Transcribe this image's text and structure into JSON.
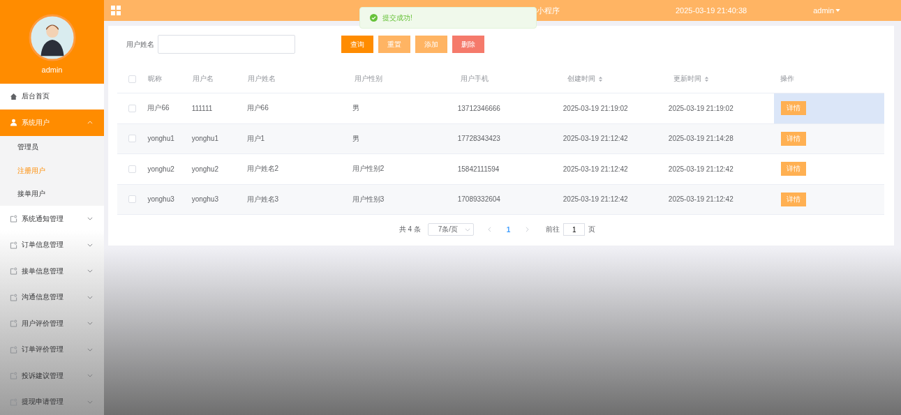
{
  "sidebar": {
    "username": "admin",
    "menu": [
      {
        "kind": "home",
        "label": "后台首页",
        "expanded": false
      },
      {
        "kind": "user",
        "label": "系统用户",
        "expanded": true,
        "children": [
          {
            "label": "管理员",
            "selected": false
          },
          {
            "label": "注册用户",
            "selected": true
          },
          {
            "label": "接单用户",
            "selected": false
          }
        ]
      },
      {
        "kind": "folder",
        "label": "系统通知管理",
        "expanded": false
      },
      {
        "kind": "folder",
        "label": "订单信息管理",
        "expanded": false
      },
      {
        "kind": "folder",
        "label": "接单信息管理",
        "expanded": false
      },
      {
        "kind": "folder",
        "label": "沟通信息管理",
        "expanded": false
      },
      {
        "kind": "folder",
        "label": "用户评价管理",
        "expanded": false
      },
      {
        "kind": "folder",
        "label": "订单评价管理",
        "expanded": false
      },
      {
        "kind": "folder",
        "label": "投诉建议管理",
        "expanded": false
      },
      {
        "kind": "folder",
        "label": "提现申请管理",
        "expanded": false
      }
    ]
  },
  "header": {
    "title": "小程序",
    "datetime": "2025-03-19 21:40:38",
    "user": "admin"
  },
  "toast": {
    "message": "提交成功!"
  },
  "search": {
    "label": "用户姓名"
  },
  "buttons": [
    {
      "kind": "primary",
      "label": "查询"
    },
    {
      "kind": "secondary",
      "label": "重置"
    },
    {
      "kind": "secondary",
      "label": "添加"
    },
    {
      "kind": "danger",
      "label": "删除"
    }
  ],
  "table": {
    "all_checked": false,
    "columns": [
      {
        "label": "昵称",
        "kind": "plain"
      },
      {
        "label": "用户名",
        "kind": "plain"
      },
      {
        "label": "用户姓名",
        "kind": "plain"
      },
      {
        "label": "用户性别",
        "kind": "plain"
      },
      {
        "label": "用户手机",
        "kind": "plain"
      },
      {
        "label": "创建时间",
        "kind": "sortable"
      },
      {
        "label": "更新时间",
        "kind": "sortable"
      },
      {
        "label": "操作",
        "kind": "plain"
      }
    ],
    "rows": [
      {
        "checked": false,
        "highlighted": true,
        "cells": [
          "用户66",
          "111111",
          "用户66",
          "男",
          "13712346666",
          "2025-03-19 21:19:02",
          "2025-03-19 21:19:02"
        ],
        "action": "详情"
      },
      {
        "checked": false,
        "highlighted": false,
        "cells": [
          "yonghu1",
          "yonghu1",
          "用户1",
          "男",
          "17728343423",
          "2025-03-19 21:12:42",
          "2025-03-19 21:14:28"
        ],
        "action": "详情"
      },
      {
        "checked": false,
        "highlighted": false,
        "cells": [
          "yonghu2",
          "yonghu2",
          "用户姓名2",
          "用户性别2",
          "15842111594",
          "2025-03-19 21:12:42",
          "2025-03-19 21:12:42"
        ],
        "action": "详情"
      },
      {
        "checked": false,
        "highlighted": false,
        "cells": [
          "yonghu3",
          "yonghu3",
          "用户姓名3",
          "用户性别3",
          "17089332604",
          "2025-03-19 21:12:42",
          "2025-03-19 21:12:42"
        ],
        "action": "详情"
      }
    ]
  },
  "pagination": {
    "total": "共 4 条",
    "page_size": "7条/页",
    "current": "1",
    "goto_label": "前往",
    "goto_value": "1",
    "page_unit": "页"
  }
}
